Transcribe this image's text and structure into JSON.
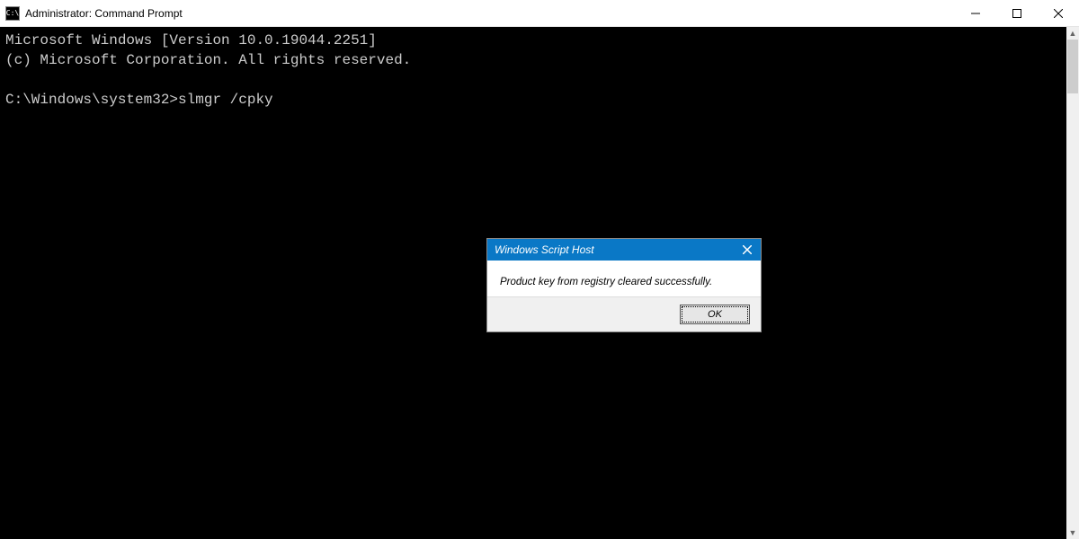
{
  "window": {
    "icon_text": "C:\\",
    "title": "Administrator: Command Prompt"
  },
  "console": {
    "line1": "Microsoft Windows [Version 10.0.19044.2251]",
    "line2": "(c) Microsoft Corporation. All rights reserved.",
    "blank": "",
    "prompt_line": "C:\\Windows\\system32>slmgr /cpky"
  },
  "dialog": {
    "title": "Windows Script Host",
    "message": "Product key from registry cleared successfully.",
    "ok": "OK"
  }
}
